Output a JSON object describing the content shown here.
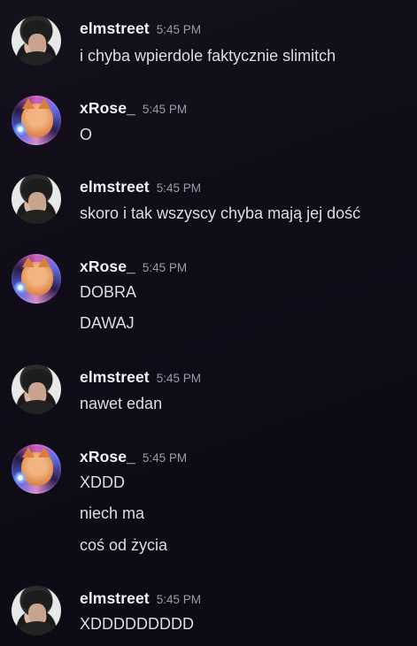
{
  "groups": [
    {
      "author": "elmstreet",
      "avatar": "elmstreet-avatar",
      "timestamp": "5:45 PM",
      "messages": [
        "i chyba wpierdole faktycznie slimitch"
      ]
    },
    {
      "author": "xRose_",
      "avatar": "xrose-avatar",
      "timestamp": "5:45 PM",
      "messages": [
        "O"
      ]
    },
    {
      "author": "elmstreet",
      "avatar": "elmstreet-avatar",
      "timestamp": "5:45 PM",
      "messages": [
        "skoro i tak wszyscy chyba mają jej dość"
      ]
    },
    {
      "author": "xRose_",
      "avatar": "xrose-avatar",
      "timestamp": "5:45 PM",
      "messages": [
        "DOBRA",
        "DAWAJ"
      ]
    },
    {
      "author": "elmstreet",
      "avatar": "elmstreet-avatar",
      "timestamp": "5:45 PM",
      "messages": [
        "nawet edan"
      ]
    },
    {
      "author": "xRose_",
      "avatar": "xrose-avatar",
      "timestamp": "5:45 PM",
      "messages": [
        "XDDD",
        "niech ma",
        "coś od życia"
      ]
    },
    {
      "author": "elmstreet",
      "avatar": "elmstreet-avatar",
      "timestamp": "5:45 PM",
      "messages": [
        "XDDDDDDDDD"
      ]
    }
  ]
}
